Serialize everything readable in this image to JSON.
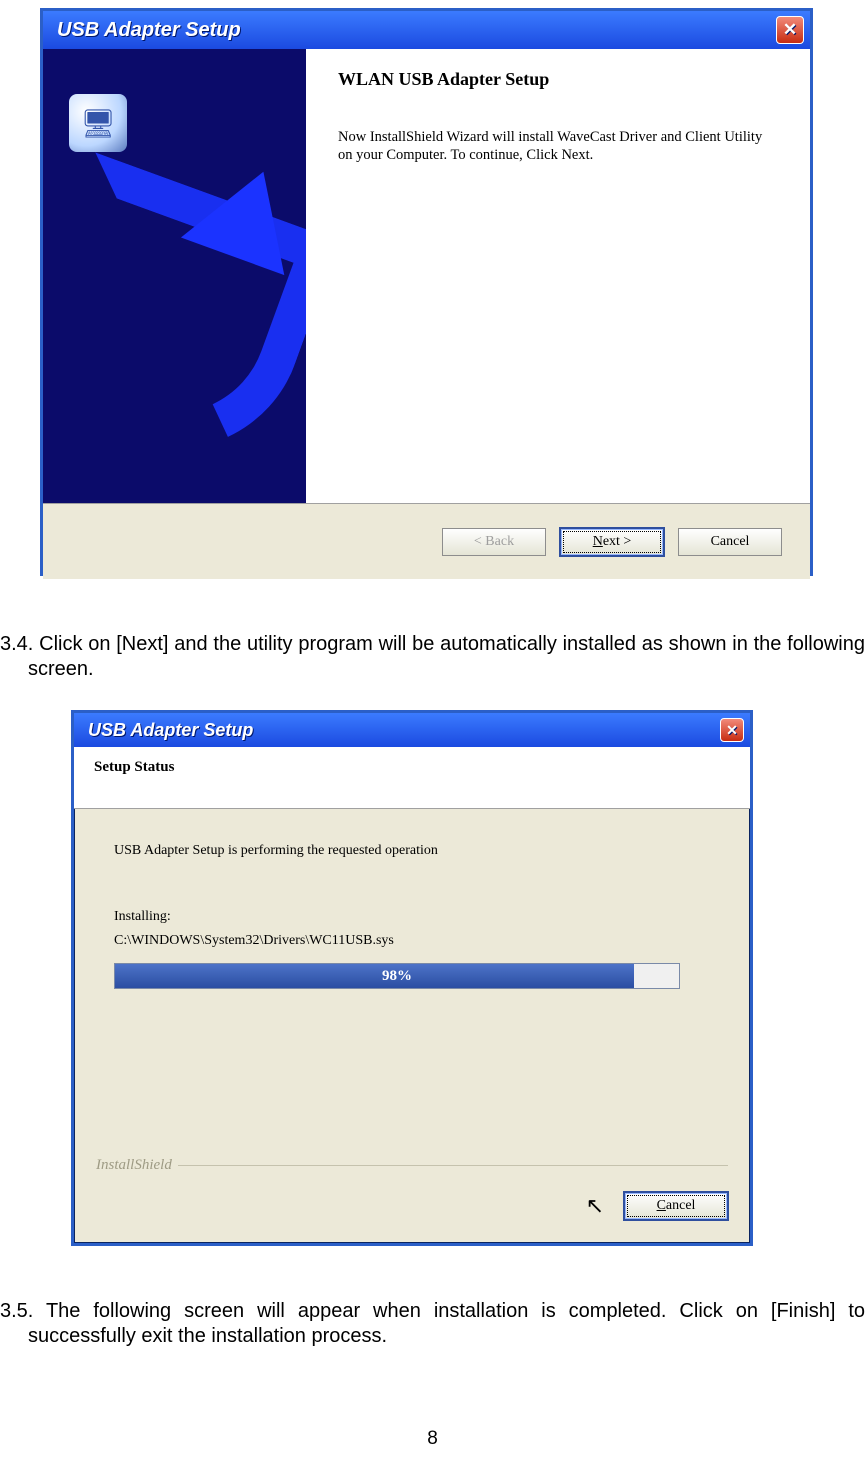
{
  "dialog1": {
    "title": "USB Adapter Setup",
    "heading": "WLAN USB Adapter Setup",
    "body": "Now InstallShield Wizard will install WaveCast Driver and Client Utility on your Computer. To continue, Click Next.",
    "buttons": {
      "back": "< Back",
      "next": "Next >",
      "cancel": "Cancel"
    }
  },
  "instruction1": "3.4. Click on [Next] and the utility program will be automatically installed as shown in the following screen.",
  "dialog2": {
    "title": "USB Adapter Setup",
    "subtitle": "Setup Status",
    "operation": "USB Adapter Setup is performing the requested operation",
    "installing_label": "Installing:",
    "installing_path": "C:\\WINDOWS\\System32\\Drivers\\WC11USB.sys",
    "progress_text": "98%",
    "brand": "InstallShield",
    "cancel": "Cancel"
  },
  "instruction2": "3.5. The following screen will appear when installation is completed. Click on [Finish] to successfully exit the installation process.",
  "page_number": "8"
}
